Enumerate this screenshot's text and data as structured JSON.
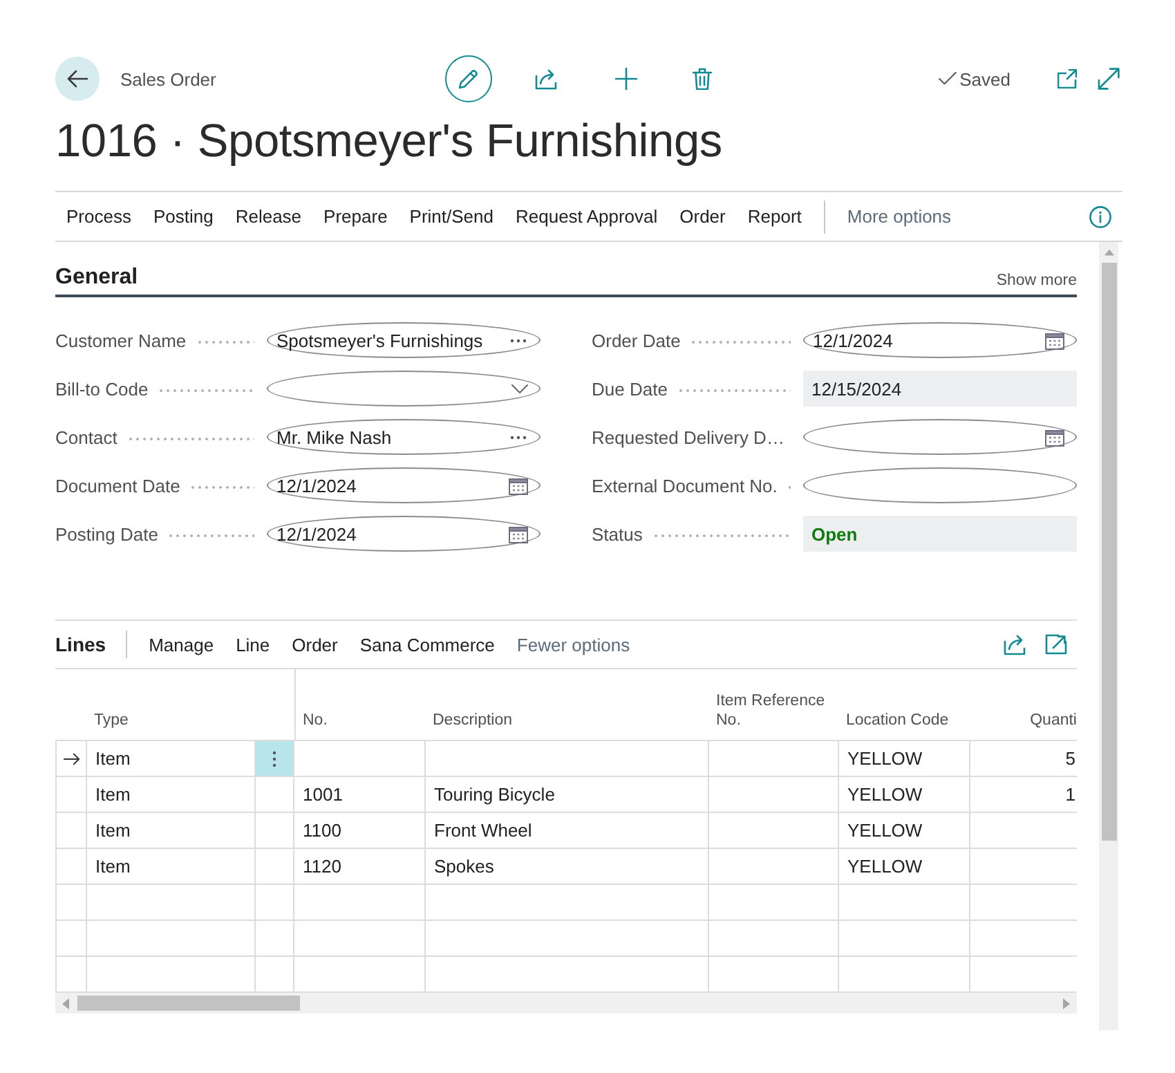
{
  "header": {
    "caption": "Sales Order",
    "edit_mode": true,
    "save_status": "Saved"
  },
  "title": "1016 · Spotsmeyer's Furnishings",
  "action_bar": {
    "actions": [
      "Process",
      "Posting",
      "Release",
      "Prepare",
      "Print/Send",
      "Request Approval",
      "Order",
      "Report"
    ],
    "more_options": "More options"
  },
  "general": {
    "title": "General",
    "show_more": "Show more",
    "left_fields": [
      {
        "label": "Customer Name",
        "kind": "lookup",
        "value": "Spotsmeyer's Furnishings"
      },
      {
        "label": "Bill-to Code",
        "kind": "dropdown"
      },
      {
        "label": "Contact",
        "kind": "lookup",
        "value": "Mr. Mike Nash"
      },
      {
        "label": "Document Date",
        "kind": "date",
        "value": "12/1/2024"
      },
      {
        "label": "Posting Date",
        "kind": "date",
        "value": "12/1/2024"
      }
    ],
    "right_fields": [
      {
        "label": "Order Date",
        "kind": "date",
        "value": "12/1/2024"
      },
      {
        "label": "Due Date",
        "kind": "readonly",
        "value": "12/15/2024"
      },
      {
        "label": "Requested Delivery D…",
        "kind": "date"
      },
      {
        "label": "External Document No.",
        "kind": "text"
      },
      {
        "label": "Status",
        "kind": "status",
        "value": "Open"
      }
    ]
  },
  "lines": {
    "title": "Lines",
    "actions": [
      "Manage",
      "Line",
      "Order",
      "Sana Commerce"
    ],
    "fewer_options": "Fewer options",
    "table": {
      "columns": [
        "Type",
        "No.",
        "Description",
        "Item Reference No.",
        "Location Code",
        "Quanti"
      ],
      "rows": [
        {
          "current": true,
          "type": "Item",
          "location_code": "YELLOW",
          "column_6": "5"
        },
        {
          "current": false,
          "type": "Item",
          "no": "1001",
          "description": "Touring Bicycle",
          "location_code": "YELLOW",
          "column_6": "1"
        },
        {
          "current": false,
          "type": "Item",
          "no": "1100",
          "description": "Front Wheel",
          "location_code": "YELLOW"
        },
        {
          "current": false,
          "type": "Item",
          "no": "1120",
          "description": "Spokes",
          "location_code": "YELLOW"
        }
      ]
    }
  }
}
